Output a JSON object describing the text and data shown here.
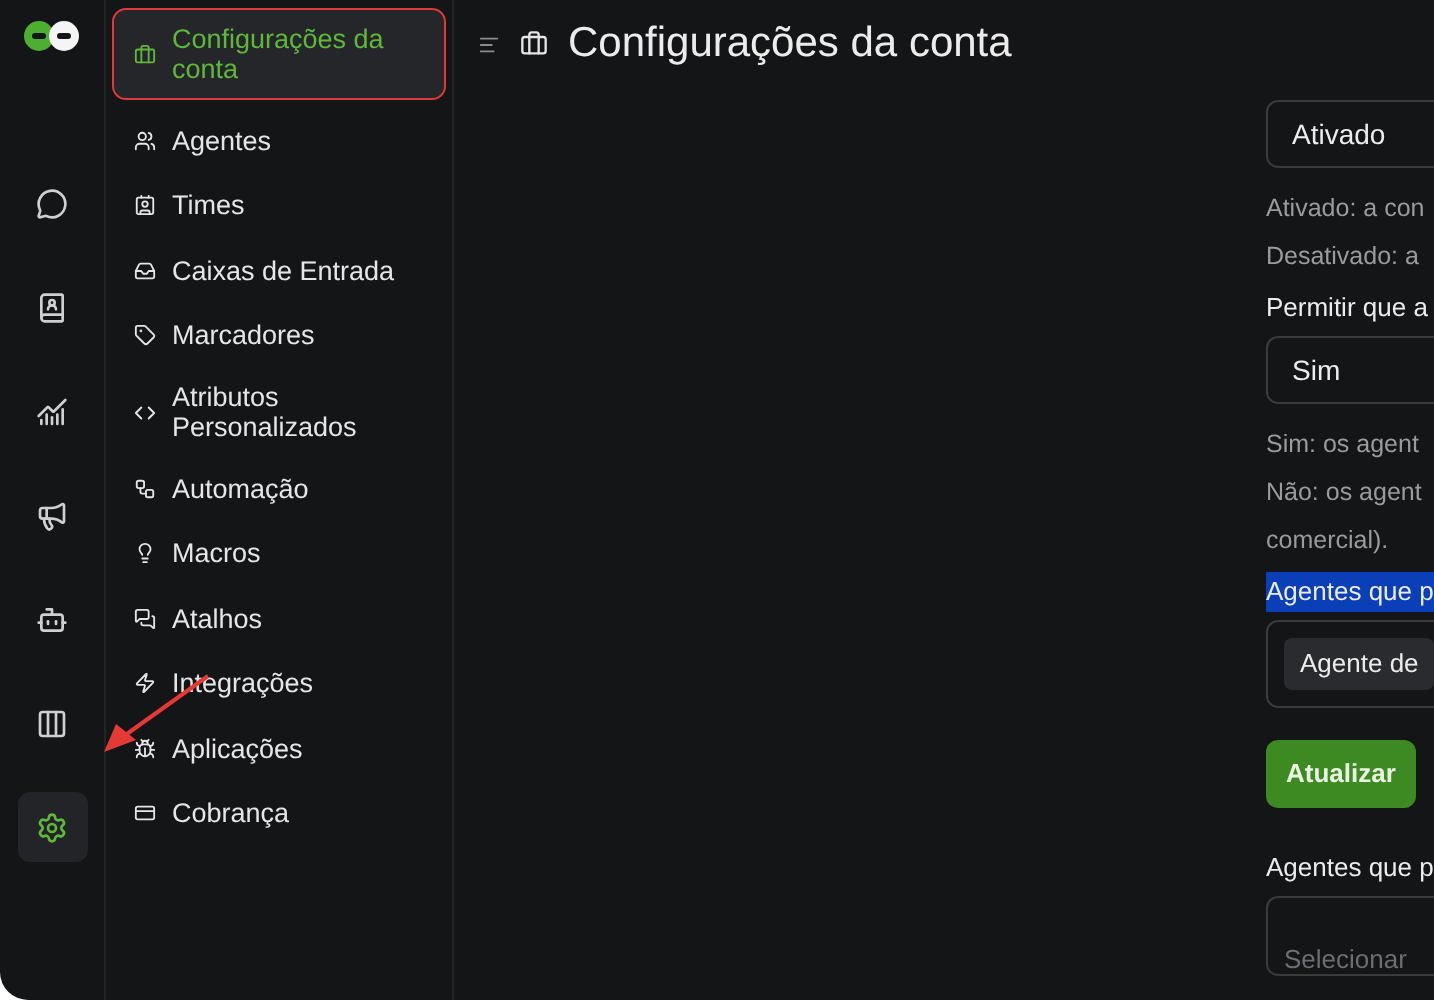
{
  "rail": {
    "items": [
      {
        "kind": "chat",
        "selected": false
      },
      {
        "kind": "contacts",
        "selected": false
      },
      {
        "kind": "reports",
        "selected": false
      },
      {
        "kind": "campaigns",
        "selected": false
      },
      {
        "kind": "bot",
        "selected": false
      },
      {
        "kind": "kanban",
        "selected": false
      },
      {
        "kind": "settings",
        "selected": true
      }
    ]
  },
  "sidebar": {
    "items": [
      {
        "label": "Configurações da conta",
        "kind": "briefcase",
        "selected": true
      },
      {
        "label": "Agentes",
        "kind": "users",
        "selected": false
      },
      {
        "label": "Times",
        "kind": "team",
        "selected": false
      },
      {
        "label": "Caixas de Entrada",
        "kind": "inbox",
        "selected": false
      },
      {
        "label": "Marcadores",
        "kind": "tag",
        "selected": false
      },
      {
        "label": "Atributos Personalizados",
        "kind": "code",
        "selected": false
      },
      {
        "label": "Automação",
        "kind": "automation",
        "selected": false
      },
      {
        "label": "Macros",
        "kind": "macro",
        "selected": false
      },
      {
        "label": "Atalhos",
        "kind": "chat",
        "selected": false
      },
      {
        "label": "Integrações",
        "kind": "bolt",
        "selected": false
      },
      {
        "label": "Aplicações",
        "kind": "app",
        "selected": false
      },
      {
        "label": "Cobrança",
        "kind": "billing",
        "selected": false
      }
    ]
  },
  "header": {
    "title": "Configurações da conta"
  },
  "form": [
    {
      "kind": "select",
      "value": "Ativado"
    },
    {
      "kind": "hint",
      "text": "Ativado: a con"
    },
    {
      "kind": "hint",
      "text": "Desativado: a"
    },
    {
      "kind": "label",
      "text": "Permitir que a",
      "highlighted": false
    },
    {
      "kind": "select",
      "value": "Sim"
    },
    {
      "kind": "hint",
      "text": "Sim: os agent"
    },
    {
      "kind": "hint",
      "text": "Não: os agent"
    },
    {
      "kind": "hint",
      "text": "comercial)."
    },
    {
      "kind": "label",
      "text": "Agentes que p",
      "highlighted": true
    },
    {
      "kind": "tags",
      "tags": [
        "Agente de"
      ]
    },
    {
      "kind": "button",
      "text": "Atualizar"
    },
    {
      "kind": "label",
      "text": "Agentes que p",
      "highlighted": false
    },
    {
      "kind": "multiselect",
      "placeholder": "Selecionar"
    }
  ]
}
